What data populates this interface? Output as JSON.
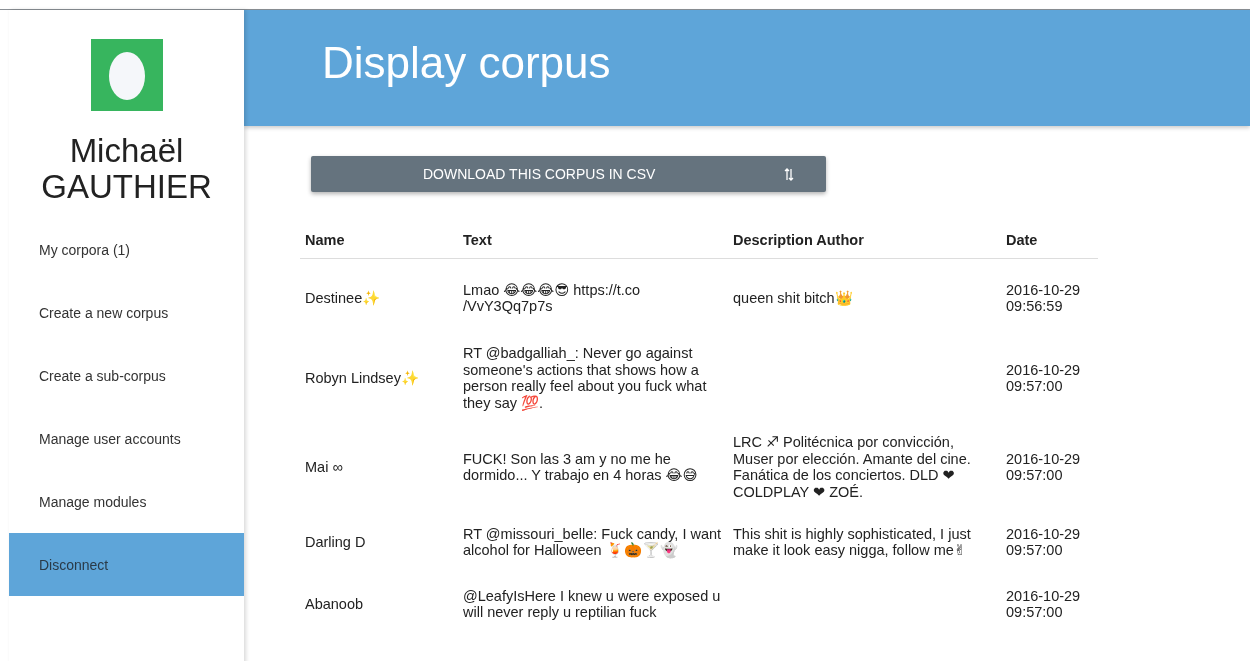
{
  "user": {
    "first_name": "Michaël",
    "last_name": "GAUTHIER"
  },
  "nav": [
    {
      "label": "My corpora (1)",
      "selected": false
    },
    {
      "label": "Create a new corpus",
      "selected": false
    },
    {
      "label": "Create a sub-corpus",
      "selected": false
    },
    {
      "label": "Manage user accounts",
      "selected": false
    },
    {
      "label": "Manage modules",
      "selected": false
    },
    {
      "label": "Disconnect",
      "selected": true
    }
  ],
  "header": {
    "title": "Display corpus"
  },
  "download_button": {
    "label": "DOWNLOAD THIS CORPUS IN CSV"
  },
  "table": {
    "columns": [
      "Name",
      "Text",
      "Description Author",
      "Date"
    ],
    "rows": [
      {
        "name": "Destinee✨",
        "text": "Lmao 😂😂😂😎 https://t.co /VvY3Qq7p7s",
        "description": "queen shit bitch👑",
        "date": "2016-10-29 09:56:59"
      },
      {
        "name": "Robyn Lindsey✨",
        "text": "RT @badgalliah_: Never go against someone's actions that shows how a person really feel about you fuck what they say 💯.",
        "description": "",
        "date": "2016-10-29 09:57:00"
      },
      {
        "name": "Mai ∞",
        "text": "FUCK! Son las 3 am y no me he dormido... Y trabajo en 4 horas 😂😅",
        "description": "LRC ♐ Politécnica por convicción, Muser por elección. Amante del cine. Fanática de los conciertos. DLD ❤ COLDPLAY ❤ ZOÉ.",
        "date": "2016-10-29 09:57:00"
      },
      {
        "name": "Darling D",
        "text": "RT @missouri_belle: Fuck candy, I want alcohol for Halloween 🍹🎃🍸👻",
        "description": "This shit is highly sophisticated, I just make it look easy nigga, follow me✌",
        "date": "2016-10-29 09:57:00"
      },
      {
        "name": "Abanoob",
        "text": "@LeafyIsHere I knew u were exposed u will never reply u reptilian fuck",
        "description": "",
        "date": "2016-10-29 09:57:00"
      }
    ]
  }
}
